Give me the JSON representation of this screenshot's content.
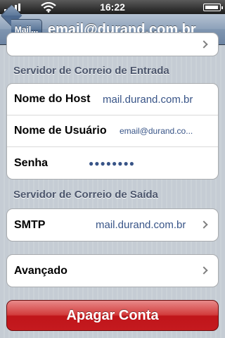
{
  "status_bar": {
    "carrier_signal_icon": "signal-bars-icon",
    "wifi_icon": "wifi-icon",
    "time": "16:22",
    "battery_icon": "battery-icon"
  },
  "nav": {
    "back_label": "Mail...",
    "title": "email@durand.com.br"
  },
  "incoming": {
    "header": "Servidor de Correio de Entrada",
    "host_label": "Nome do Host",
    "host_value": "mail.durand.com.br",
    "username_label": "Nome de Usuário",
    "username_value": "email@durand.co...",
    "password_label": "Senha",
    "password_value": "●●●●●●●●"
  },
  "outgoing": {
    "header": "Servidor de Correio de Saída",
    "smtp_label": "SMTP",
    "smtp_value": "mail.durand.com.br"
  },
  "advanced": {
    "label": "Avançado"
  },
  "delete_account": {
    "label": "Apagar Conta",
    "color": "#c41a1f"
  }
}
